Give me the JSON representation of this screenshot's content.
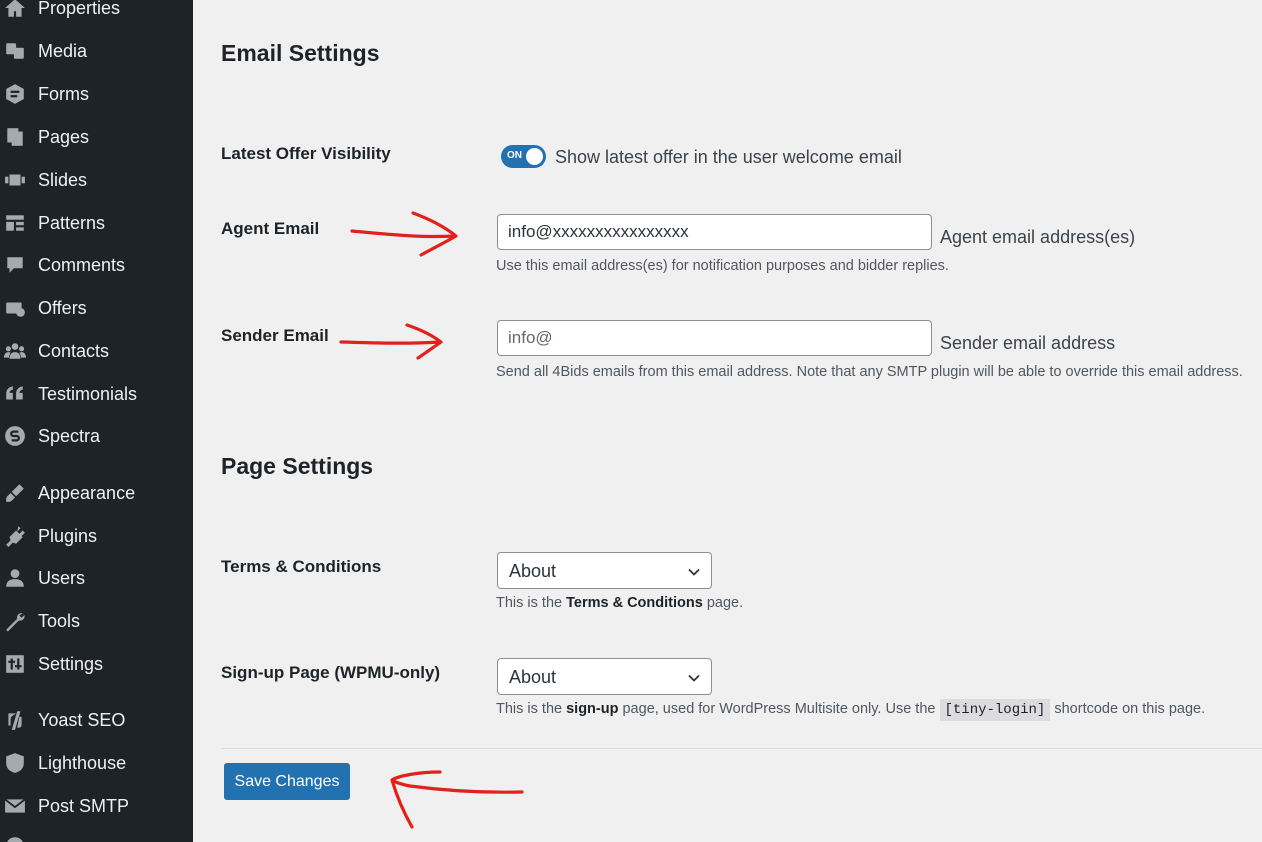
{
  "sidebar": {
    "items": [
      {
        "label": "Properties",
        "icon": "home-icon"
      },
      {
        "label": "Media",
        "icon": "media-icon"
      },
      {
        "label": "Forms",
        "icon": "forms-icon"
      },
      {
        "label": "Pages",
        "icon": "pages-icon"
      },
      {
        "label": "Slides",
        "icon": "slides-icon"
      },
      {
        "label": "Patterns",
        "icon": "patterns-icon"
      },
      {
        "label": "Comments",
        "icon": "comments-icon"
      },
      {
        "label": "Offers",
        "icon": "offers-icon"
      },
      {
        "label": "Contacts",
        "icon": "contacts-icon"
      },
      {
        "label": "Testimonials",
        "icon": "quote-icon"
      },
      {
        "label": "Spectra",
        "icon": "spectra-icon"
      },
      {
        "label": "Appearance",
        "icon": "appearance-icon"
      },
      {
        "label": "Plugins",
        "icon": "plugins-icon"
      },
      {
        "label": "Users",
        "icon": "users-icon"
      },
      {
        "label": "Tools",
        "icon": "tools-icon"
      },
      {
        "label": "Settings",
        "icon": "settings-icon"
      },
      {
        "label": "Yoast SEO",
        "icon": "yoast-icon"
      },
      {
        "label": "Lighthouse",
        "icon": "shield-icon"
      },
      {
        "label": "Post SMTP",
        "icon": "mail-icon"
      }
    ]
  },
  "email_settings": {
    "title": "Email Settings",
    "offer_visibility": {
      "label": "Latest Offer Visibility",
      "toggle_text": "ON",
      "toggle_on": true,
      "text": "Show latest offer in the user welcome email"
    },
    "agent_email": {
      "label": "Agent Email",
      "value": "info@xxxxxxxxxxxxxxxx",
      "suffix": "Agent email address(es)",
      "description": "Use this email address(es) for notification purposes and bidder replies."
    },
    "sender_email": {
      "label": "Sender Email",
      "placeholder": "info@",
      "suffix": "Sender email address",
      "description": "Send all 4Bids emails from this email address. Note that any SMTP plugin will be able to override this email address."
    }
  },
  "page_settings": {
    "title": "Page Settings",
    "terms": {
      "label": "Terms & Conditions",
      "selected": "About",
      "desc_pre": "This is the ",
      "desc_bold": "Terms & Conditions",
      "desc_post": " page."
    },
    "signup": {
      "label": "Sign-up Page (WPMU-only)",
      "selected": "About",
      "desc_pre": "This is the ",
      "desc_bold": "sign-up",
      "desc_mid": " page, used for WordPress Multisite only. Use the ",
      "desc_code": "[tiny-login]",
      "desc_post": " shortcode on this page."
    }
  },
  "actions": {
    "save_label": "Save Changes"
  },
  "colors": {
    "accent": "#2271b1",
    "sidebar_bg": "#1d2327",
    "annotation": "#e3211c"
  }
}
